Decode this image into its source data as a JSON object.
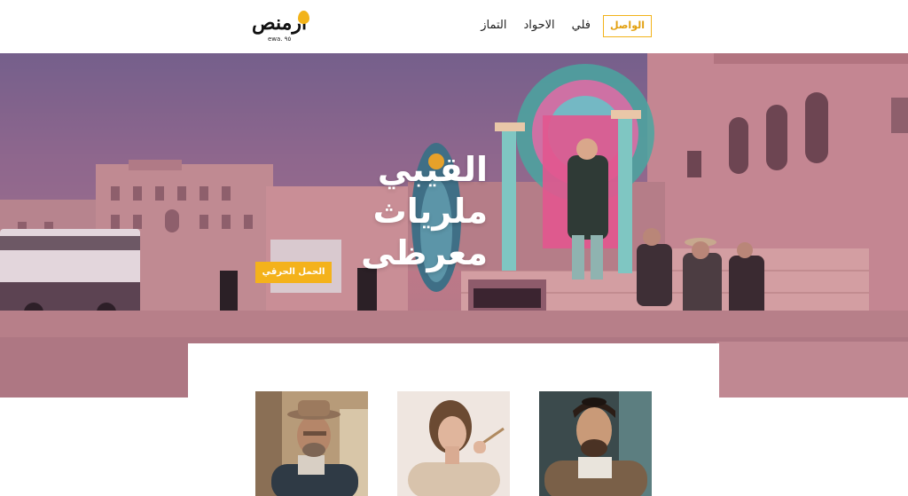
{
  "header": {
    "logo_text": "ارمنص",
    "logo_sub": "ewa. ٩٥",
    "nav": [
      {
        "label": "فلي"
      },
      {
        "label": "الاحواد"
      },
      {
        "label": "التماز"
      }
    ],
    "cta_label": "الواصل"
  },
  "hero": {
    "title_line1": "القيبي",
    "title_line2": "ملرياث معرظى",
    "button_label": "الحمل الحرقي"
  },
  "cards": [
    {
      "image": "man-hat-portrait"
    },
    {
      "image": "woman-portrait"
    },
    {
      "image": "young-man-portrait"
    }
  ],
  "colors": {
    "accent": "#f4b21b",
    "hero_tint": "#c07888"
  }
}
